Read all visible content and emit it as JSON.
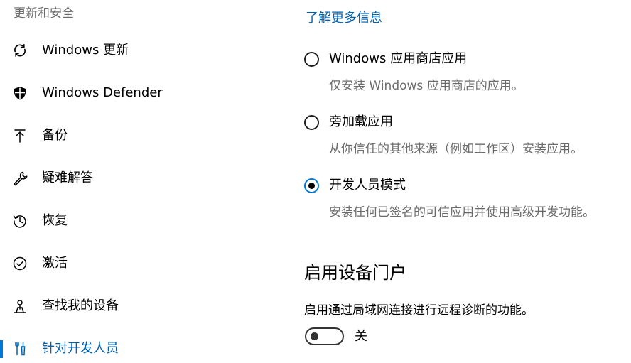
{
  "sidebar": {
    "section_title": "更新和安全",
    "items": [
      {
        "label": "Windows 更新",
        "icon": "refresh-icon"
      },
      {
        "label": "Windows Defender",
        "icon": "shield-icon"
      },
      {
        "label": "备份",
        "icon": "upload-arrow-icon"
      },
      {
        "label": "疑难解答",
        "icon": "wrench-icon"
      },
      {
        "label": "恢复",
        "icon": "history-icon"
      },
      {
        "label": "激活",
        "icon": "check-circle-icon"
      },
      {
        "label": "查找我的设备",
        "icon": "person-location-icon"
      },
      {
        "label": "针对开发人员",
        "icon": "developer-tools-icon",
        "active": true
      }
    ]
  },
  "content": {
    "learn_more_link": "了解更多信息",
    "options": [
      {
        "label": "Windows 应用商店应用",
        "description": "仅安装 Windows 应用商店的应用。",
        "selected": false
      },
      {
        "label": "旁加载应用",
        "description": "从你信任的其他来源（例如工作区）安装应用。",
        "selected": false
      },
      {
        "label": "开发人员模式",
        "description": "安装任何已签名的可信应用并使用高级开发功能。",
        "selected": true
      }
    ],
    "device_portal": {
      "heading": "启用设备门户",
      "description": "启用通过局域网连接进行远程诊断的功能。",
      "toggle_state": "关",
      "enabled": false
    }
  },
  "colors": {
    "accent": "#0078d7",
    "link": "#0063b1",
    "secondary_text": "#6b6b6b"
  }
}
